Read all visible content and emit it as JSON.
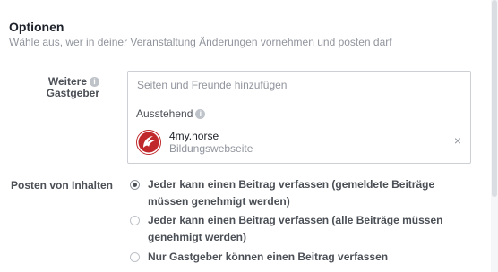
{
  "options": {
    "title": "Optionen",
    "subtitle": "Wähle aus, wer in deiner Veranstaltung Änderungen vornehmen und posten darf"
  },
  "hosts": {
    "label_line1": "Weitere",
    "label_line2": "Gastgeber",
    "info_icon": "info-icon",
    "input_placeholder": "Seiten und Freunde hinzufügen",
    "input_value": "",
    "pending_label": "Ausstehend",
    "pending": [
      {
        "name": "4my.horse",
        "category": "Bildungswebseite",
        "avatar_icon": "page-logo-icon",
        "avatar_color": "#c0282b",
        "remove_icon": "close-icon",
        "remove_glyph": "×"
      }
    ]
  },
  "posting": {
    "label": "Posten von Inhalten",
    "options": [
      {
        "label": "Jeder kann einen Beitrag verfassen (gemeldete Beiträge müssen genehmigt werden)",
        "checked": true
      },
      {
        "label": "Jeder kann einen Beitrag verfassen (alle Beiträge müssen genehmigt werden)",
        "checked": false
      },
      {
        "label": "Nur Gastgeber können einen Beitrag verfassen",
        "checked": false
      }
    ]
  },
  "colors": {
    "text_primary": "#1d2129",
    "text_secondary": "#90949c",
    "border": "#ccd0d5",
    "brand_red": "#c0282b"
  }
}
